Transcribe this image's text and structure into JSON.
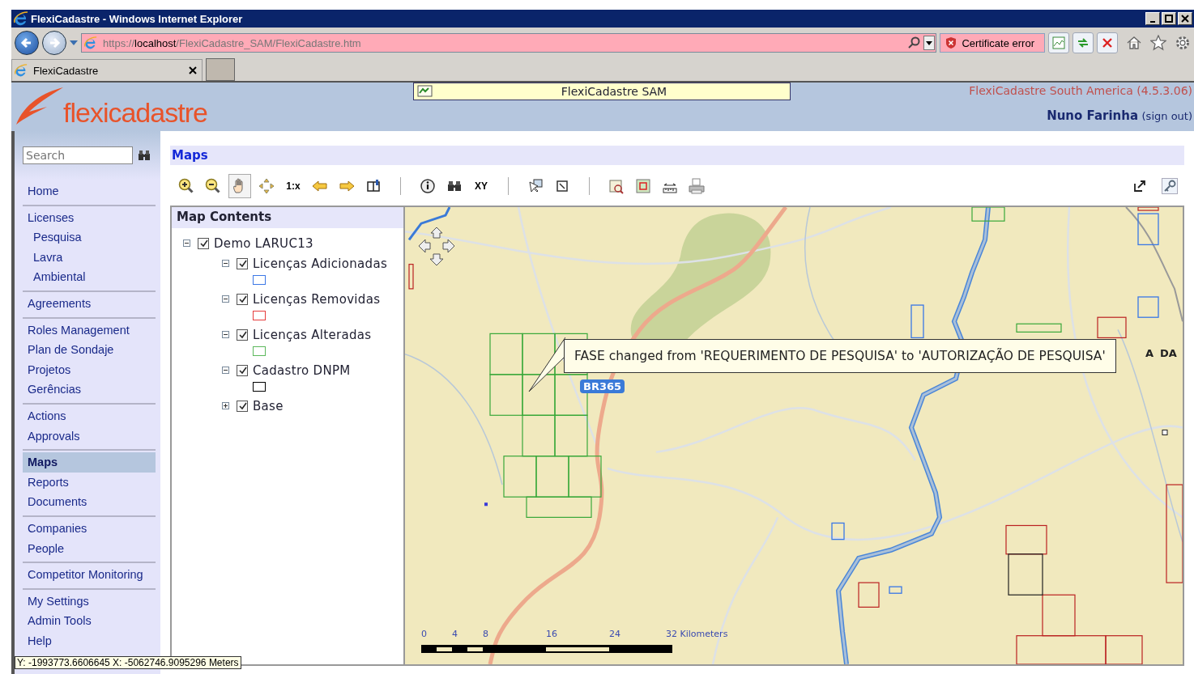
{
  "window": {
    "title": "FlexiCadastre - Windows Internet Explorer"
  },
  "address_bar": {
    "scheme": "https://",
    "host": "localhost",
    "path": "/FlexiCadastre_SAM/FlexiCadastre.htm",
    "certificate": "Certificate error"
  },
  "tabs": [
    {
      "label": "FlexiCadastre",
      "selected": true
    }
  ],
  "header": {
    "logo": "flexicadastre",
    "site_box": "FlexiCadastre SAM",
    "version": "FlexiCadastre South America (4.5.3.06)",
    "user": "Nuno Farinha",
    "sign_out": "(sign out)"
  },
  "search": {
    "placeholder": "Search"
  },
  "nav": [
    {
      "items": [
        {
          "label": "Home",
          "selected": false
        }
      ]
    },
    {
      "items": [
        {
          "label": "Licenses",
          "selected": false,
          "children": [
            {
              "label": "Pesquisa",
              "selected": false
            },
            {
              "label": "Lavra",
              "selected": false
            },
            {
              "label": "Ambiental",
              "selected": false
            }
          ]
        }
      ]
    },
    {
      "items": [
        {
          "label": "Agreements",
          "selected": false
        }
      ]
    },
    {
      "items": [
        {
          "label": "Roles Management",
          "selected": false
        },
        {
          "label": "Plan de Sondaje",
          "selected": false
        },
        {
          "label": "Projetos",
          "selected": false
        },
        {
          "label": "Gerências",
          "selected": false
        }
      ]
    },
    {
      "items": [
        {
          "label": "Actions",
          "selected": false
        },
        {
          "label": "Approvals",
          "selected": false
        }
      ]
    },
    {
      "items": [
        {
          "label": "Maps",
          "selected": true
        },
        {
          "label": "Reports",
          "selected": false
        },
        {
          "label": "Documents",
          "selected": false
        }
      ]
    },
    {
      "items": [
        {
          "label": "Companies",
          "selected": false
        },
        {
          "label": "People",
          "selected": false
        }
      ]
    },
    {
      "items": [
        {
          "label": "Competitor Monitoring",
          "selected": false
        }
      ]
    },
    {
      "items": [
        {
          "label": "My Settings",
          "selected": false
        },
        {
          "label": "Admin Tools",
          "selected": false
        },
        {
          "label": "Help",
          "selected": false
        }
      ]
    }
  ],
  "page_title": "Maps",
  "toolbar": [
    {
      "kind": "zoom-in",
      "selected": false
    },
    {
      "kind": "zoom-out",
      "selected": false
    },
    {
      "kind": "pan",
      "selected": true
    },
    {
      "kind": "full-extent",
      "selected": false
    },
    {
      "kind": "scale",
      "label": "1:x",
      "selected": false
    },
    {
      "kind": "back",
      "selected": false
    },
    {
      "kind": "forward",
      "selected": false
    },
    {
      "kind": "bookmark",
      "selected": false
    },
    {
      "kind": "separator"
    },
    {
      "kind": "info",
      "selected": false
    },
    {
      "kind": "find",
      "selected": false
    },
    {
      "kind": "xy",
      "label": "XY",
      "selected": false
    },
    {
      "kind": "separator"
    },
    {
      "kind": "select",
      "selected": false
    },
    {
      "kind": "clear",
      "selected": false
    },
    {
      "kind": "separator"
    },
    {
      "kind": "zoom-to",
      "selected": false
    },
    {
      "kind": "extent",
      "selected": false
    },
    {
      "kind": "measure",
      "selected": false
    },
    {
      "kind": "print",
      "selected": false
    }
  ],
  "map_contents": {
    "title": "Map Contents",
    "layers": [
      {
        "label": "Demo LARUC13",
        "checked": true,
        "expanded": true,
        "children": [
          {
            "label": "Licenças Adicionadas",
            "checked": true,
            "expanded": true,
            "color": "#3c78e6"
          },
          {
            "label": "Licenças Removidas",
            "checked": true,
            "expanded": true,
            "color": "#e63c3c"
          },
          {
            "label": "Licenças Alteradas",
            "checked": true,
            "expanded": true,
            "color": "#5cb85c"
          },
          {
            "label": "Cadastro DNPM",
            "checked": true,
            "expanded": true,
            "color": "#000000"
          },
          {
            "label": "Base",
            "checked": true,
            "expanded": false
          }
        ]
      }
    ]
  },
  "map": {
    "callout": "FASE changed from 'REQUERIMENTO DE PESQUISA' to 'AUTORIZAÇÃO DE PESQUISA'",
    "road_label": "BR365",
    "edge_labels": [
      "A",
      "DA"
    ],
    "scale_labels": [
      "0",
      "4",
      "8",
      "16",
      "24",
      "32 Kilometers"
    ]
  },
  "coordinates": "Y: -1993773.6606645  X: -5062746.9095296 Meters"
}
